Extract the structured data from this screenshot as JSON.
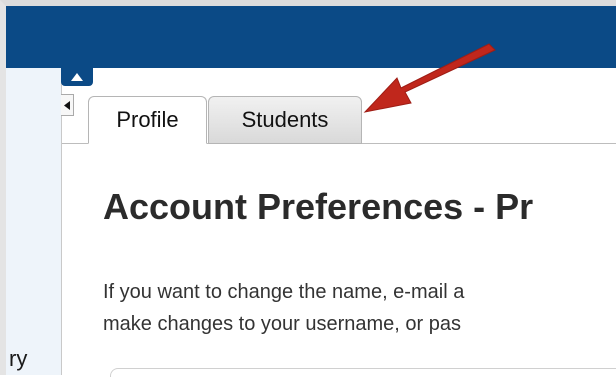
{
  "tabs": [
    {
      "label": "Profile",
      "active": true
    },
    {
      "label": "Students",
      "active": false
    }
  ],
  "page_title": "Account Preferences - Pr",
  "description": {
    "line1": "If you want to change the name, e-mail a",
    "line2": "make changes to your username, or pas"
  },
  "left_panel": {
    "visible_text": "ry"
  },
  "icons": {
    "collapse_up": "triangle-up-icon",
    "collapse_left": "triangle-left-icon",
    "annotation": "red-arrow-annotation"
  },
  "colors": {
    "header_blue": "#0b4a86",
    "annotation_red": "#c0271c",
    "left_panel_bg": "#eef4fa"
  }
}
